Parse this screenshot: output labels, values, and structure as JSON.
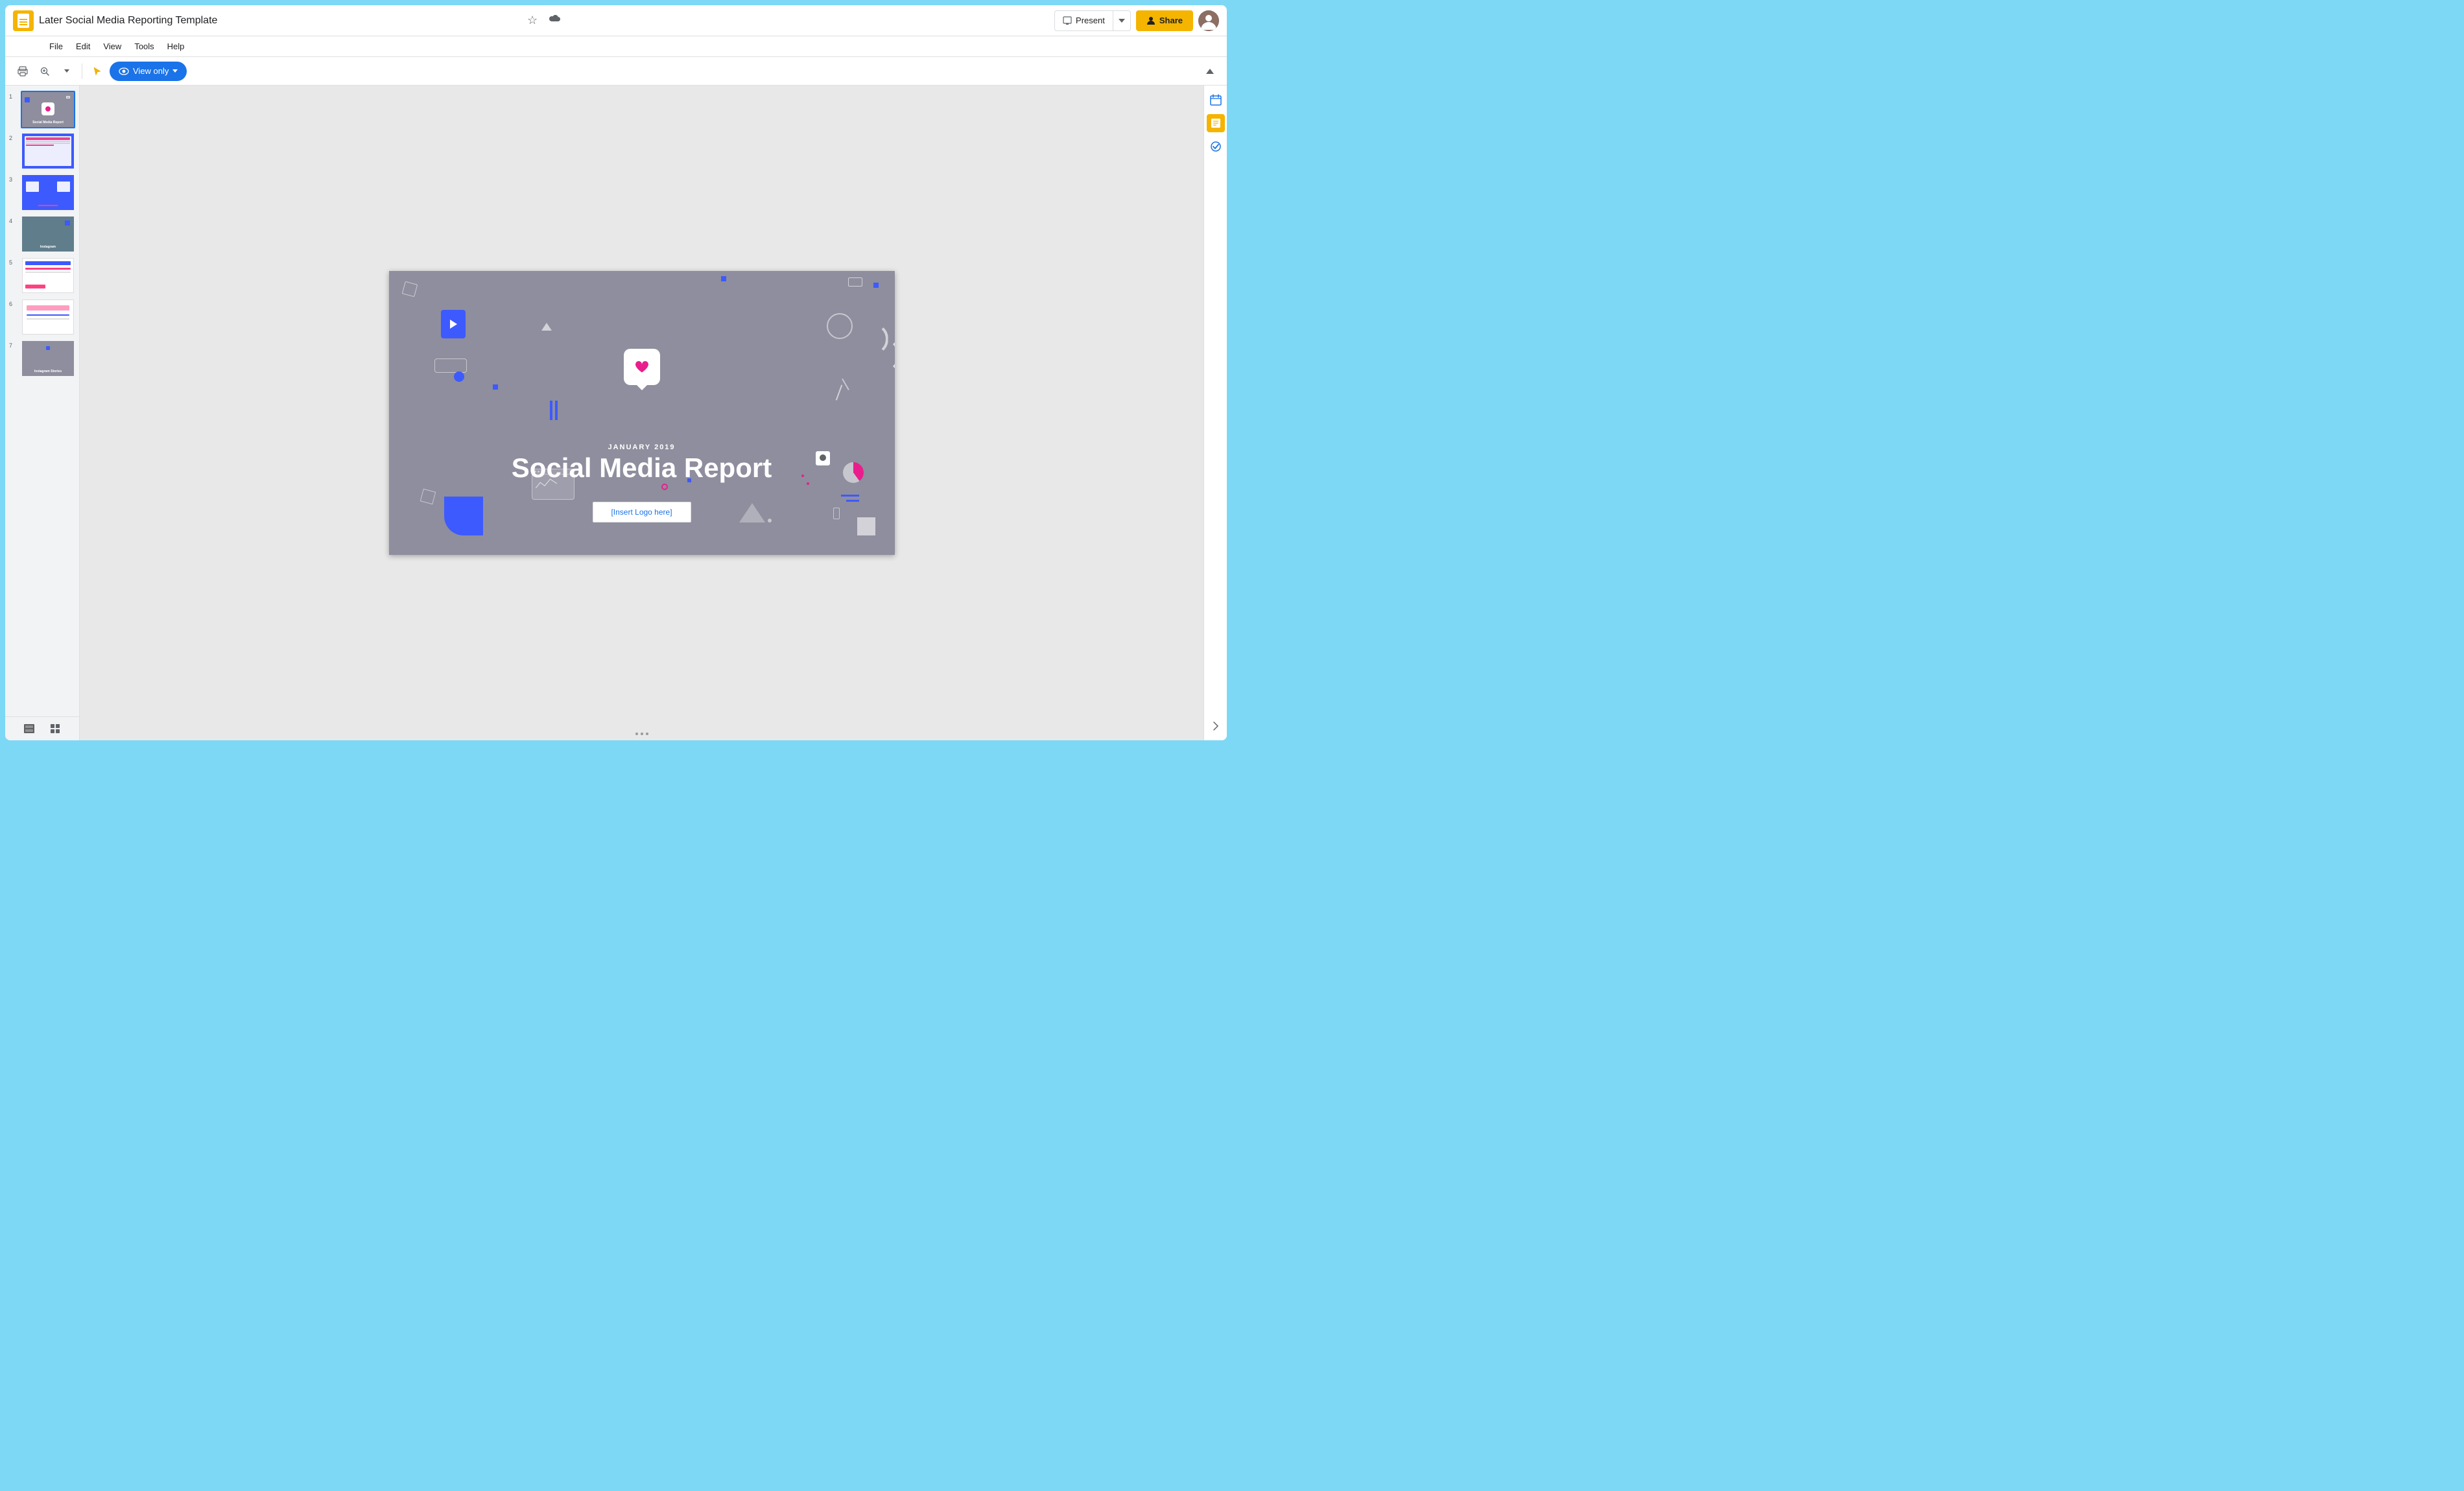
{
  "app": {
    "background_color": "#7dd8f5",
    "icon_color": "#f4b400"
  },
  "header": {
    "doc_title": "Later Social Media Reporting Template",
    "star_icon": "☆",
    "cloud_icon": "☁",
    "present_label": "Present",
    "present_icon": "⬜",
    "chevron_icon": "▾",
    "share_label": "Share",
    "share_icon": "👤"
  },
  "menu": {
    "items": [
      "File",
      "Edit",
      "View",
      "Tools",
      "Help"
    ]
  },
  "toolbar": {
    "print_icon": "🖨",
    "zoom_icon": "⊕",
    "zoom_chevron": "▾",
    "cursor_icon": "↖",
    "view_only_label": "View only",
    "eye_icon": "👁",
    "chevron_icon": "▾",
    "collapse_icon": "⌃"
  },
  "slides": [
    {
      "number": 1,
      "type": "title",
      "label": "Social Media Report",
      "active": true
    },
    {
      "number": 2,
      "type": "table",
      "label": "",
      "active": false
    },
    {
      "number": 3,
      "type": "comparison",
      "label": "",
      "active": false
    },
    {
      "number": 4,
      "type": "instagram-dark",
      "label": "Instagram",
      "active": false
    },
    {
      "number": 5,
      "type": "instagram-light",
      "label": "",
      "active": false
    },
    {
      "number": 6,
      "type": "light-table",
      "label": "",
      "active": false
    },
    {
      "number": 7,
      "type": "stories",
      "label": "Instagram Stories",
      "active": false
    }
  ],
  "slide_view": {
    "month": "JANUARY 2019",
    "title": "Social Media Report",
    "logo_placeholder": "[Insert Logo here]",
    "dots": 3
  },
  "right_sidebar": {
    "calendar_icon": "📅",
    "note_icon": "📝",
    "check_icon": "✓"
  },
  "slide_panel_bottom": {
    "list_icon": "≡",
    "grid_icon": "⊞"
  }
}
